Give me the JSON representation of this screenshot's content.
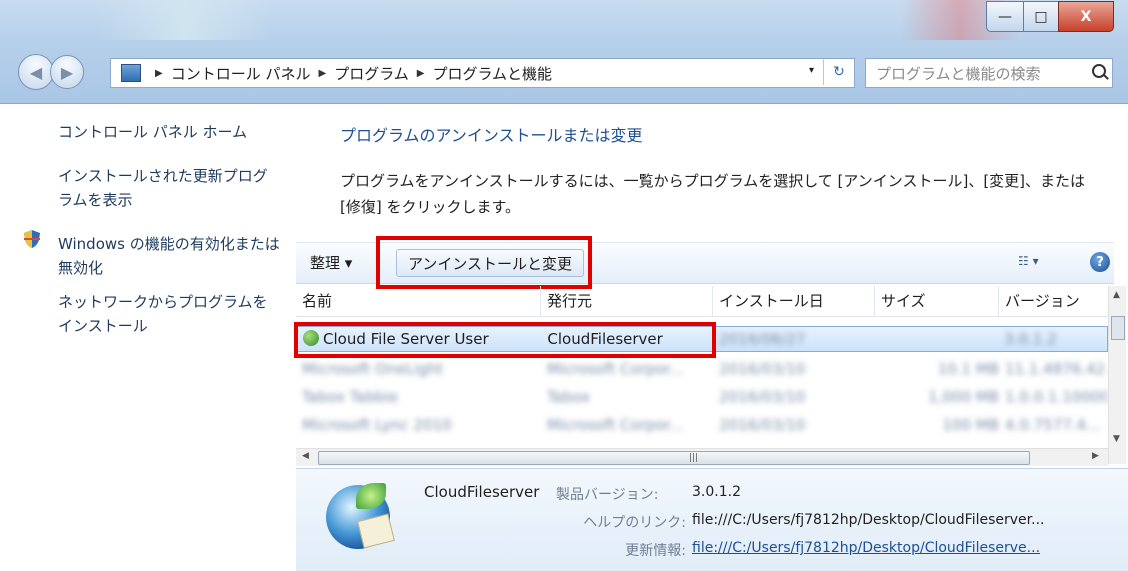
{
  "window": {
    "controls": {
      "minimize": "—",
      "maximize": "□",
      "close": "X"
    }
  },
  "address_bar": {
    "crumbs": [
      "コントロール パネル",
      "プログラム",
      "プログラムと機能"
    ],
    "dropdown": "▾",
    "refresh": "↻"
  },
  "search": {
    "placeholder": "プログラムと機能の検索"
  },
  "sidebar": {
    "items": [
      {
        "label": "コントロール パネル ホーム"
      },
      {
        "label": "インストールされた更新プログラムを表示"
      },
      {
        "label": "Windows の機能の有効化または無効化"
      },
      {
        "label": "ネットワークからプログラムをインストール"
      }
    ]
  },
  "main": {
    "heading": "プログラムのアンインストールまたは変更",
    "description": "プログラムをアンインストールするには、一覧からプログラムを選択して [アンインストール]、[変更]、または [修復] をクリックします。"
  },
  "toolbar": {
    "organize_label": "整理 ▾",
    "uninstall_label": "アンインストールと変更",
    "view_label": "☷ ▾",
    "help_label": "?"
  },
  "table": {
    "columns": [
      "名前",
      "発行元",
      "インストール日",
      "サイズ",
      "バージョン"
    ],
    "rows": [
      {
        "name": "Cloud File Server User",
        "publisher": "CloudFileserver",
        "date": "2016/06/27",
        "size": "",
        "version": "3.0.1.2"
      },
      {
        "name": "Microsoft OneLight",
        "publisher": "Microsoft Corpor...",
        "date": "2016/03/10",
        "size": "10.1 MB",
        "version": "11.1.4876.42..."
      },
      {
        "name": "Tabox Tabbie",
        "publisher": "Tabox",
        "date": "2016/03/10",
        "size": "1,000 MB",
        "version": "1.0.0.1.10000"
      },
      {
        "name": "Microsoft Lync 2010",
        "publisher": "Microsoft Corpor...",
        "date": "2016/03/10",
        "size": "100 MB",
        "version": "4.0.7577.4..."
      }
    ]
  },
  "details": {
    "publisher": "CloudFileserver",
    "version_label": "製品バージョン:",
    "version_value": "3.0.1.2",
    "help_label": "ヘルプのリンク:",
    "help_value": "file:///C:/Users/fj7812hp/Desktop/CloudFileserver...",
    "update_label": "更新情報:",
    "update_value": "file:///C:/Users/fj7812hp/Desktop/CloudFileserve..."
  },
  "colors": {
    "highlight": "#e00000",
    "link": "#1e4f94",
    "selection": "#cde3fa"
  }
}
